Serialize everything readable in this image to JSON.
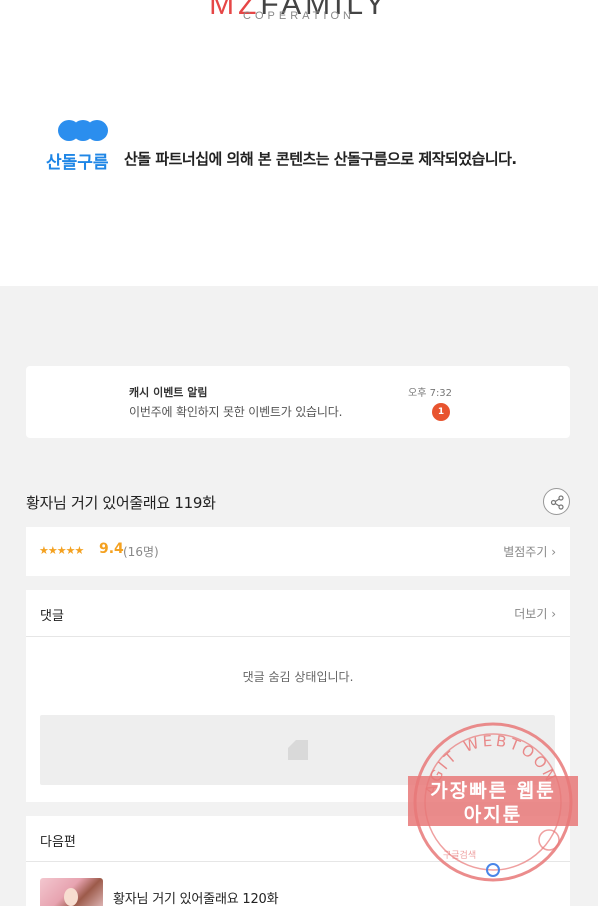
{
  "header": {
    "logo_main_red": "MZ",
    "logo_main_rest": "FAMILY",
    "logo_sub": "COPERATION",
    "brand": "산돌구름",
    "notice": "산돌 파트너십에 의해 본 콘텐츠는 산돌구름으로 제작되었습니다."
  },
  "notification": {
    "title": "캐시 이벤트 알림",
    "message": "이번주에 확인하지 못한 이벤트가 있습니다.",
    "time": "오후 7:32",
    "badge": "1"
  },
  "episode": {
    "title": "황자님 거기 있어줄래요 119화",
    "share_icon": "share-icon"
  },
  "rating": {
    "stars": "★★★★★",
    "score": "9.4",
    "votes": "(16명)",
    "rate_label": "별점주기 ›"
  },
  "comments": {
    "title": "댓글",
    "more_label": "더보기 ›",
    "hidden_message": "댓글 숨김 상태입니다."
  },
  "next": {
    "title": "다음편",
    "episode_title": "황자님 거기 있어줄래요 120화"
  },
  "watermark": {
    "arc_text": "AGIT WEBTOON",
    "line1": "가장빠른 웹툰",
    "line2": "아지툰",
    "bottom_text": "구글검색",
    "color": "#e87878"
  },
  "colors": {
    "accent": "#f4a120",
    "brand_blue": "#1f86e6",
    "badge": "#e8542f"
  }
}
